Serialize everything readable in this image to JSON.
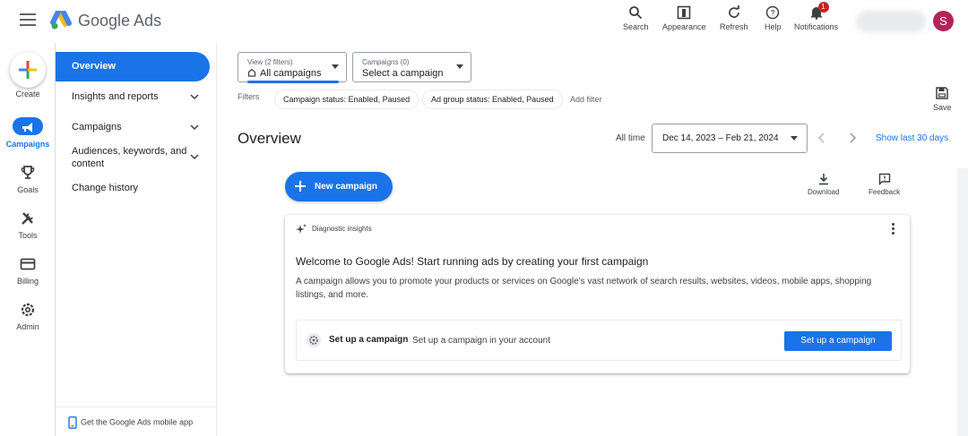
{
  "header": {
    "brand": "Google Ads",
    "tools": [
      {
        "label": "Search",
        "icon": "search-icon"
      },
      {
        "label": "Appearance",
        "icon": "appearance-icon"
      },
      {
        "label": "Refresh",
        "icon": "refresh-icon"
      },
      {
        "label": "Help",
        "icon": "help-icon"
      },
      {
        "label": "Notifications",
        "icon": "bell-icon",
        "badge": "1"
      }
    ],
    "avatar_letter": "S"
  },
  "rail": {
    "create_label": "Create",
    "items": [
      {
        "label": "Campaigns",
        "icon": "megaphone-icon",
        "active": true
      },
      {
        "label": "Goals",
        "icon": "trophy-icon"
      },
      {
        "label": "Tools",
        "icon": "tools-icon"
      },
      {
        "label": "Billing",
        "icon": "credit-card-icon"
      },
      {
        "label": "Admin",
        "icon": "gear-icon"
      }
    ]
  },
  "nav": {
    "items": [
      {
        "label": "Overview",
        "active": true
      },
      {
        "label": "Insights and reports",
        "expandable": true
      },
      {
        "label": "Campaigns",
        "expandable": true
      },
      {
        "label": "Audiences, keywords, and content",
        "expandable": true
      },
      {
        "label": "Change history"
      }
    ],
    "footer": "Get the Google Ads mobile app"
  },
  "toolbar": {
    "view_small": "View (2 filters)",
    "view_value": "All campaigns",
    "campaign_small": "Campaigns (0)",
    "campaign_value": "Select a campaign",
    "filters_label": "Filters",
    "chips": [
      "Campaign status: Enabled, Paused",
      "Ad group status: Enabled, Paused"
    ],
    "add_filter": "Add filter",
    "save": "Save"
  },
  "main": {
    "title": "Overview",
    "all_time": "All time",
    "date_range": "Dec 14, 2023 – Feb 21, 2024",
    "show_last": "Show last 30 days",
    "new_campaign": "New campaign",
    "download": "Download",
    "feedback": "Feedback"
  },
  "card": {
    "label": "Diagnostic insights",
    "headline": "Welcome to Google Ads! Start running ads by creating your first campaign",
    "description": "A campaign allows you to promote your products or services on Google's vast network of search results, websites, videos, mobile apps, shopping listings, and more.",
    "setup_title": "Set up a campaign",
    "setup_sub": "Set up a campaign in your account",
    "setup_button": "Set up a campaign"
  },
  "colors": {
    "accent": "#1a73e8",
    "avatar": "#b3245a",
    "badge": "#c5221f"
  }
}
